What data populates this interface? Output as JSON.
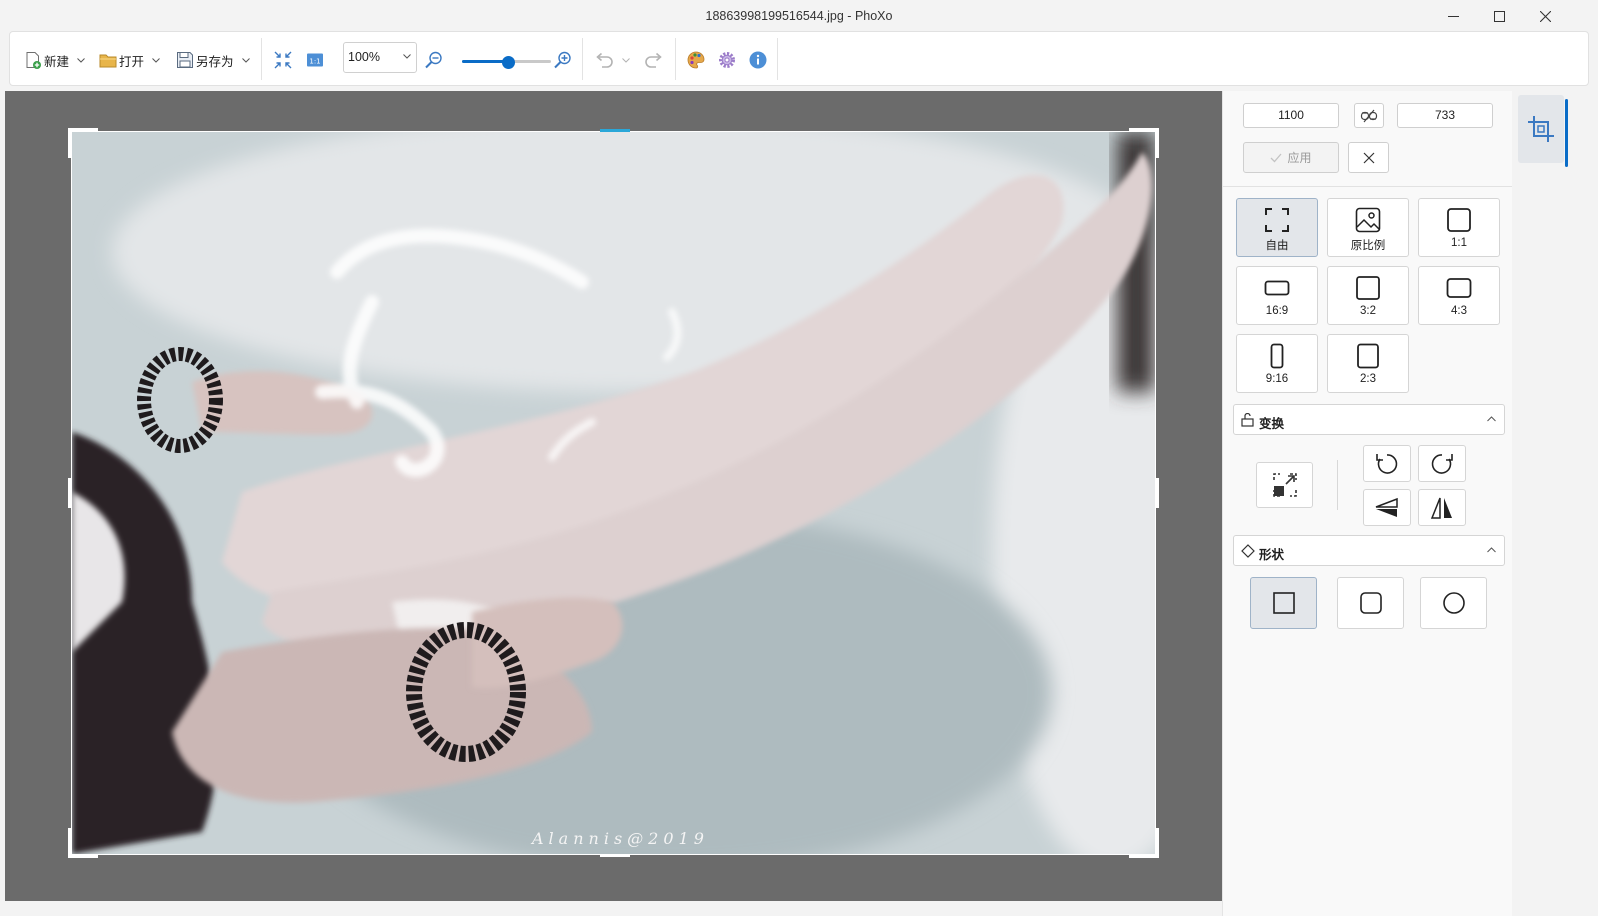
{
  "window": {
    "title": "18863998199516544.jpg - PhoXo",
    "controls": [
      "minimize",
      "maximize",
      "close"
    ]
  },
  "toolbar": {
    "new_label": "新建",
    "open_label": "打开",
    "save_as_label": "另存为",
    "zoom_value": "100%",
    "zoom_slider_fraction": 0.5,
    "icons": [
      "fit-window-icon",
      "actual-size-icon",
      "zoom-out-icon",
      "zoom-in-icon",
      "undo-icon",
      "redo-icon",
      "palette-icon",
      "settings-icon",
      "info-icon"
    ]
  },
  "canvas": {
    "watermark": "Alannis@2019"
  },
  "crop_panel": {
    "width": "1100",
    "height": "733",
    "apply_label": "应用",
    "ratios": [
      {
        "label": "自由",
        "icon": "free-crop-icon",
        "active": true
      },
      {
        "label": "原比例",
        "icon": "original-ratio-icon",
        "active": false
      },
      {
        "label": "1:1",
        "icon": "ratio-1-1-icon",
        "active": false
      },
      {
        "label": "16:9",
        "icon": "ratio-16-9-icon",
        "active": false
      },
      {
        "label": "3:2",
        "icon": "ratio-3-2-icon",
        "active": false
      },
      {
        "label": "4:3",
        "icon": "ratio-4-3-icon",
        "active": false
      },
      {
        "label": "9:16",
        "icon": "ratio-9-16-icon",
        "active": false
      },
      {
        "label": "2:3",
        "icon": "ratio-2-3-icon",
        "active": false
      }
    ],
    "transform_title": "变换",
    "shape_title": "形状",
    "shapes": [
      "rectangle",
      "rounded-rectangle",
      "circle"
    ]
  },
  "colors": {
    "accent": "#0a6cc7",
    "canvas_bg": "#6b6b6b",
    "panel_bg": "#f9f9f9",
    "active_tile": "#e3e6ea"
  }
}
